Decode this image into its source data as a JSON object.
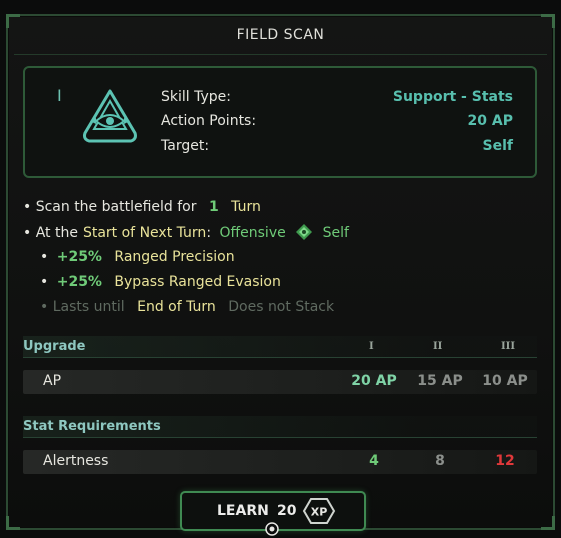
{
  "title": "FIELD SCAN",
  "tier": "I",
  "skill_icon": "triangle-eye-icon",
  "info": [
    {
      "label": "Skill Type:",
      "value": "Support - Stats"
    },
    {
      "label": "Action Points:",
      "value": "20 AP"
    },
    {
      "label": "Target:",
      "value": "Self"
    }
  ],
  "description": {
    "line1": {
      "prefix": "• Scan the battlefield for",
      "num": "1",
      "unit": "Turn"
    },
    "line2": {
      "prefix": "• At the",
      "highlight": "Start of Next Turn",
      "colon": ":",
      "kind": "Offensive",
      "target": "Self",
      "icon": "green-diamond-icon"
    },
    "line3": {
      "bullet": "•",
      "amount": "+25%",
      "effect": "Ranged Precision"
    },
    "line4": {
      "bullet": "•",
      "amount": "+25%",
      "effect": "Bypass Ranged Evasion"
    },
    "line5": {
      "prefix": "• Lasts until",
      "highlight": "End of Turn",
      "suffix": "Does not Stack"
    }
  },
  "upgrade": {
    "header": "Upgrade",
    "levels": [
      "I",
      "II",
      "III"
    ],
    "row": {
      "name": "AP",
      "values": [
        "20 AP",
        "15 AP",
        "10 AP"
      ]
    }
  },
  "requirements": {
    "header": "Stat Requirements",
    "row": {
      "name": "Alertness",
      "values": [
        "4",
        "8",
        "12"
      ]
    }
  },
  "learn_button": {
    "label": "LEARN",
    "cost": "20",
    "currency": "XP"
  },
  "colors": {
    "accent_green": "#6fcb78",
    "teal": "#58bfae",
    "highlight_yellow": "#e9e39a",
    "warning_red": "#e0383a"
  }
}
